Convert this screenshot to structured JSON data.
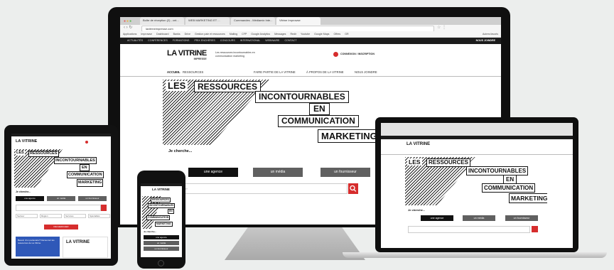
{
  "browser": {
    "tabs": [
      "Boîte de réception (2) - cnt...",
      "WEB MARKETING ET ...",
      "Commandes - Médiamix Inte...",
      "Vitrine Improwse"
    ],
    "url": "lavitrineimpresse.com",
    "bookmarks": [
      "Applications",
      "Improwse",
      "Dashboard",
      "Banks",
      "Drive",
      "Gestion paie et ressources",
      "Mailing",
      "CFP",
      "Google Analytics",
      "Messages",
      "Redir",
      "Youtube",
      "Google Maps",
      "Offres",
      "GR"
    ],
    "other_bookmarks": "Autres favoris"
  },
  "site": {
    "topbar_links": [
      "ACTUALITÉS",
      "CONFÉRENCES",
      "FORMATIONS",
      "PRIX ENCHÈRES",
      "CONCOURS",
      "INTERNATIONAL",
      "WEBINAIRE",
      "CONTACT",
      "FOIRE AUX QUESTIONS",
      "À PROPOS",
      "PARTENAIRES"
    ],
    "join_label": "NOUS JOINDRE",
    "logo": "LA VITRINE",
    "logo_sub": "IMPRESSE",
    "tagline": "Les ressources incontournables en communication marketing",
    "login": "CONNEXION / INSCRIPTION",
    "nav_left": [
      "ACCUEIL",
      "RESSOURCES"
    ],
    "nav_right": [
      "FAIRE PARTIE DE LA VITRINE",
      "À PROPOS DE LA VITRINE",
      "NOUS JOINDRE"
    ],
    "hero_words": [
      "LES",
      "RESSOURCES",
      "INCONTOURNABLES",
      "EN",
      "COMMUNICATION",
      "MARKETING"
    ],
    "search_label": "Je cherche...",
    "search_tabs": [
      "une agence",
      "un média",
      "un fournisseur"
    ],
    "search_placeholder": "Recherche",
    "tablet_filters": [
      "Secteur",
      "Région",
      "Services",
      "Spécialités"
    ],
    "tablet_cta": "RECHERCHER",
    "tablet_promo": "Besoin d’un partenaire? Découvrez les ressources de La Vitrine",
    "tablet_promo_logo": "LA VITRINE"
  },
  "colors": {
    "background": "#eceeed",
    "accent_red": "#d62d2d",
    "tab_active": "#111111",
    "tab_inactive": "#606060",
    "topbar": "#1c1c1c"
  }
}
